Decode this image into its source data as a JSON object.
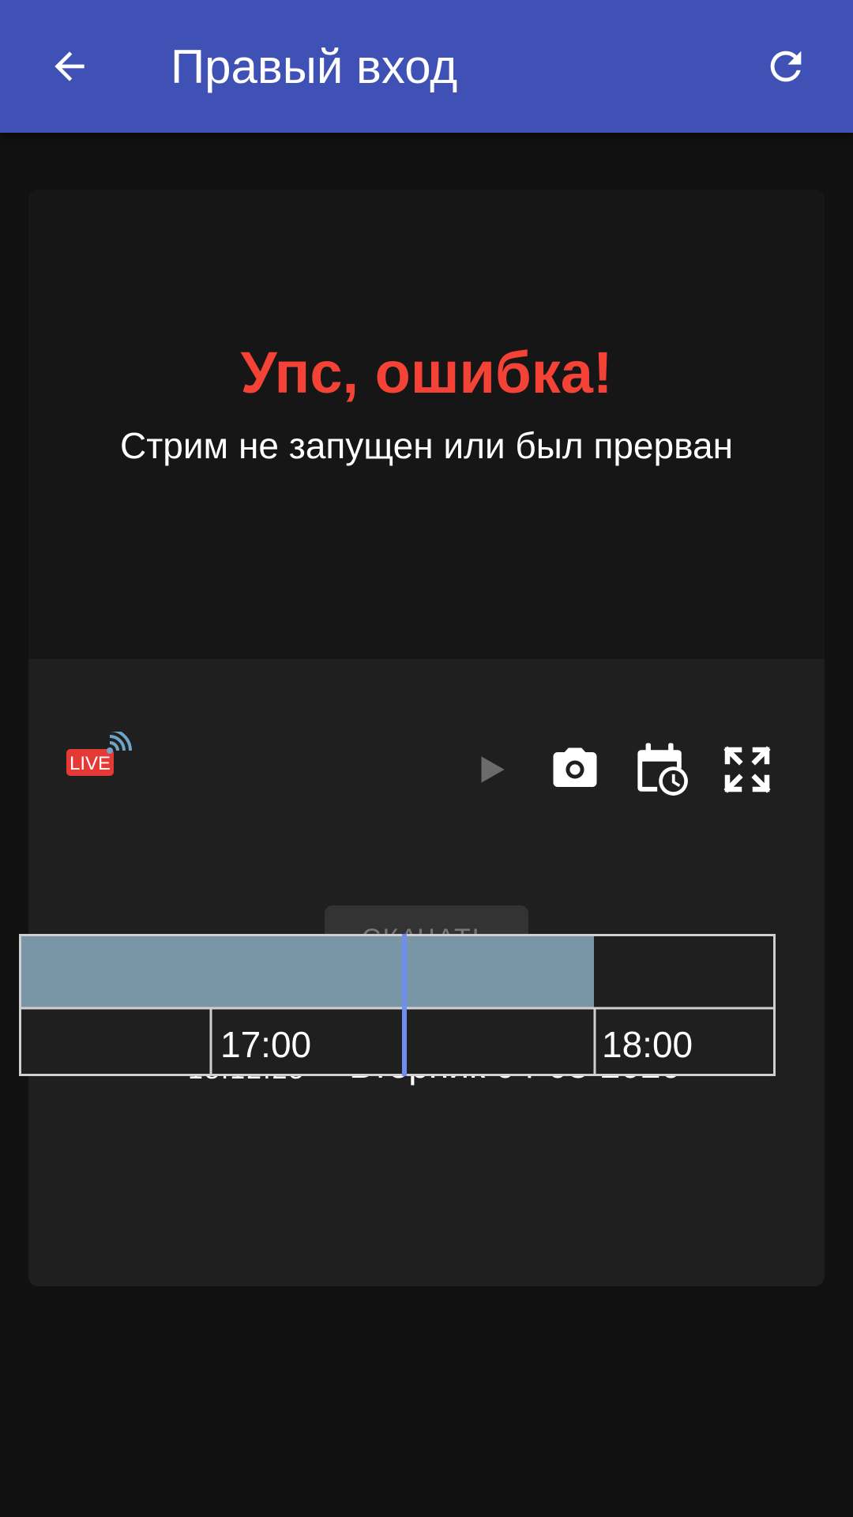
{
  "appbar": {
    "title": "Правый вход",
    "background": "#3f51b5"
  },
  "player": {
    "error_title": "Упс, ошибка!",
    "error_subtitle": "Стрим не запущен или был прерван",
    "error_color": "#f44336"
  },
  "controls": {
    "live_badge": "LIVE",
    "live_badge_color": "#e53935",
    "live_wave_color": "#6fa3c7",
    "download_label": "СКАЧАТЬ",
    "icons": [
      "back-arrow-icon",
      "refresh-icon",
      "live-stream-icon",
      "play-icon",
      "camera-icon",
      "calendar-clock-icon",
      "fullscreen-icon"
    ]
  },
  "timeline": {
    "current_time": "18:12:25",
    "date": "Вторник 04-08-2020",
    "hour_labels": [
      "17:00",
      "18:00"
    ],
    "recorded_color": "#7896a6",
    "cursor_color": "#6f8ff0"
  }
}
